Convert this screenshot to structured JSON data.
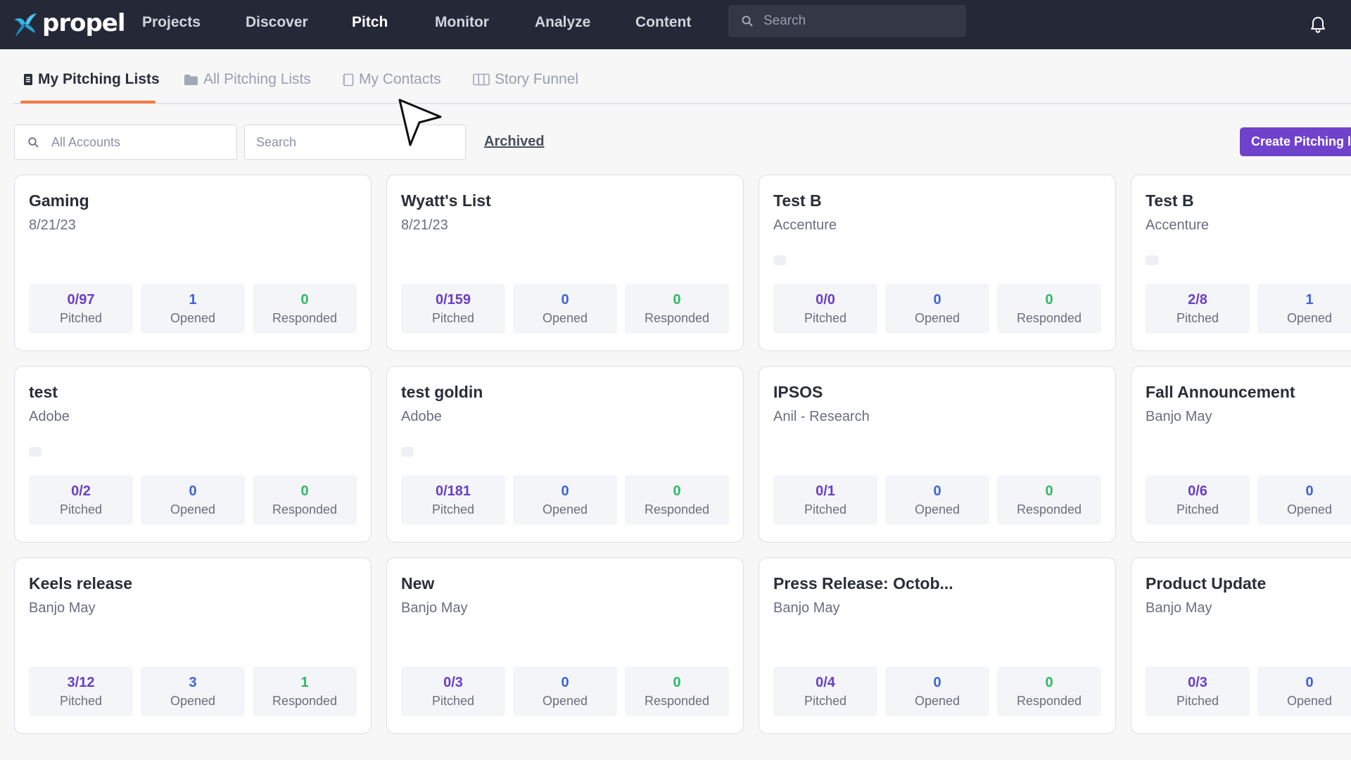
{
  "brand": {
    "name": "propel",
    "accent_color": "#7042cc",
    "tab_accent": "#f47a45"
  },
  "nav": {
    "items": [
      {
        "label": "Projects",
        "active": false
      },
      {
        "label": "Discover",
        "active": false
      },
      {
        "label": "Pitch",
        "active": true
      },
      {
        "label": "Monitor",
        "active": false
      },
      {
        "label": "Analyze",
        "active": false
      },
      {
        "label": "Content",
        "active": false
      }
    ],
    "search_placeholder": "Search",
    "notification_icon": "bell-icon"
  },
  "tabs": [
    {
      "label": "My Pitching Lists",
      "icon": "list-icon",
      "active": true
    },
    {
      "label": "All Pitching Lists",
      "icon": "folder-icon",
      "active": false
    },
    {
      "label": "My Contacts",
      "icon": "contact-card-icon",
      "active": false
    },
    {
      "label": "Story Funnel",
      "icon": "columns-icon",
      "active": false
    }
  ],
  "filters": {
    "accounts_placeholder": "All Accounts",
    "search_placeholder": "Search",
    "archived_label": "Archived",
    "create_label": "Create Pitching l"
  },
  "stat_labels": {
    "pitched": "Pitched",
    "opened": "Opened",
    "responded": "Responded"
  },
  "cards": [
    {
      "title": "Gaming",
      "subtitle": "8/21/23",
      "dot": false,
      "pitched": "0/97",
      "opened": "1",
      "responded": "0"
    },
    {
      "title": "Wyatt's List",
      "subtitle": "8/21/23",
      "dot": false,
      "pitched": "0/159",
      "opened": "0",
      "responded": "0"
    },
    {
      "title": "Test B",
      "subtitle": "Accenture",
      "dot": true,
      "pitched": "0/0",
      "opened": "0",
      "responded": "0"
    },
    {
      "title": "Test B",
      "subtitle": "Accenture",
      "dot": true,
      "pitched": "2/8",
      "opened": "1",
      "responded": ""
    },
    {
      "title": "test",
      "subtitle": "Adobe",
      "dot": true,
      "pitched": "0/2",
      "opened": "0",
      "responded": "0"
    },
    {
      "title": "test goldin",
      "subtitle": "Adobe",
      "dot": true,
      "pitched": "0/181",
      "opened": "0",
      "responded": "0"
    },
    {
      "title": "IPSOS",
      "subtitle": "Anil - Research",
      "dot": false,
      "pitched": "0/1",
      "opened": "0",
      "responded": "0"
    },
    {
      "title": "Fall Announcement",
      "subtitle": "Banjo May",
      "dot": false,
      "pitched": "0/6",
      "opened": "0",
      "responded": ""
    },
    {
      "title": "Keels release",
      "subtitle": "Banjo May",
      "dot": false,
      "pitched": "3/12",
      "opened": "3",
      "responded": "1"
    },
    {
      "title": "New",
      "subtitle": "Banjo May",
      "dot": false,
      "pitched": "0/3",
      "opened": "0",
      "responded": "0"
    },
    {
      "title": "Press Release: Octob...",
      "subtitle": "Banjo May",
      "dot": false,
      "pitched": "0/4",
      "opened": "0",
      "responded": "0"
    },
    {
      "title": "Product Update",
      "subtitle": "Banjo May",
      "dot": false,
      "pitched": "0/3",
      "opened": "0",
      "responded": ""
    }
  ]
}
